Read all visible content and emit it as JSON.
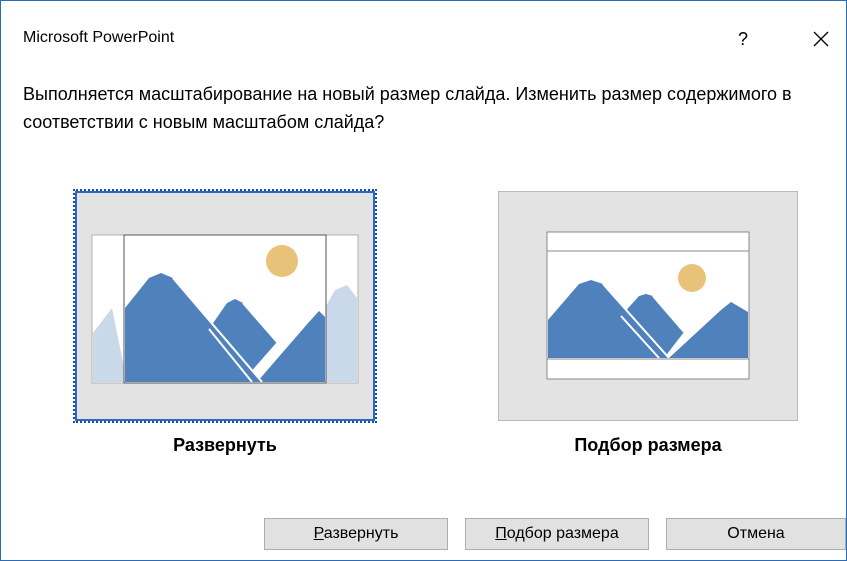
{
  "window": {
    "title": "Microsoft PowerPoint",
    "help_label": "?"
  },
  "message": "Выполняется масштабирование на новый размер слайда. Изменить размер содержимого в соответствии с новым масштабом слайда?",
  "options": {
    "maximize_label": "Развернуть",
    "fit_label": "Подбор размера"
  },
  "buttons": {
    "maximize": {
      "mnemonic": "Р",
      "rest": "азвернуть"
    },
    "fit": {
      "mnemonic": "П",
      "rest": "одбор размера"
    },
    "cancel": "Отмена"
  },
  "colors": {
    "mountain": "#4f81bd",
    "mountain_faded": "#c9d9ea",
    "sun": "#e9c27a",
    "selection": "#2869c8"
  }
}
